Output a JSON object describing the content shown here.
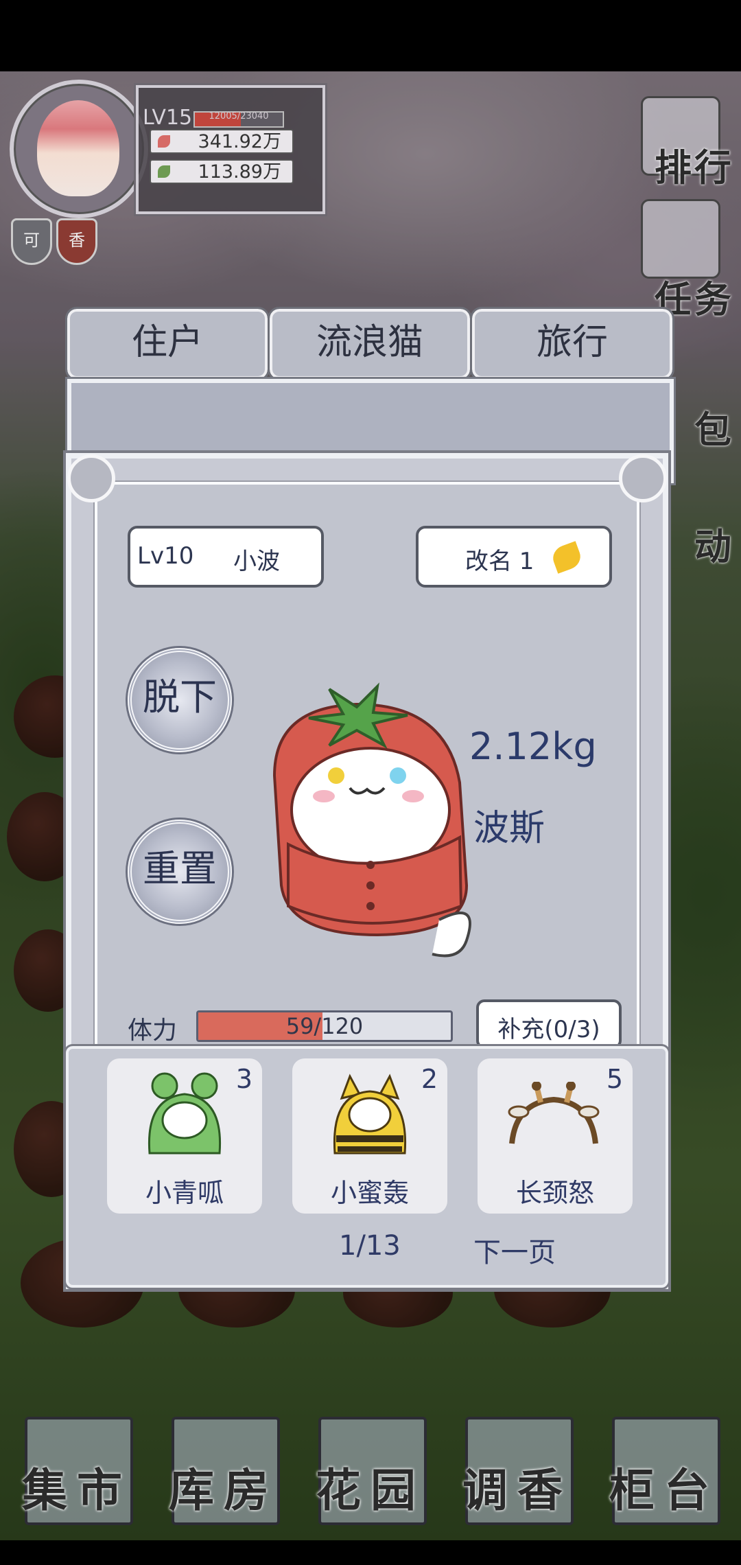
{
  "player": {
    "level": "LV15",
    "xp_text": "12005/23040",
    "xp_fraction": 0.52,
    "resource_1": "341.92万",
    "resource_2": "113.89万",
    "badge_1": "可",
    "badge_2": "香"
  },
  "side_menu": [
    "排行",
    "任务",
    "包",
    "动"
  ],
  "tabs": [
    "住户",
    "流浪猫",
    "旅行"
  ],
  "cat": {
    "level": "Lv10",
    "name": "小波",
    "rename_label": "改名 1",
    "undress_label": "脱下",
    "reset_label": "重置",
    "weight": "2.12kg",
    "breed": "波斯",
    "stamina_label": "体力",
    "stamina_current": 59,
    "stamina_max": 120,
    "stamina_text": "59/120",
    "refill_label": "补充(0/3)"
  },
  "costumes": [
    {
      "name": "小青呱",
      "count": "3",
      "color": "#7cc36a"
    },
    {
      "name": "小蜜轰",
      "count": "2",
      "color": "#f1cf3b"
    },
    {
      "name": "长颈怒",
      "count": "5",
      "color": "#c99a5b"
    }
  ],
  "pagination": {
    "page": "1/13",
    "next_label": "下一页"
  },
  "bottom_nav": [
    "集市",
    "库房",
    "花园",
    "调香",
    "柜台"
  ],
  "colors": {
    "accent_red": "#d96a5c",
    "text_navy": "#2f3a66",
    "panel": "#c8cad4"
  }
}
